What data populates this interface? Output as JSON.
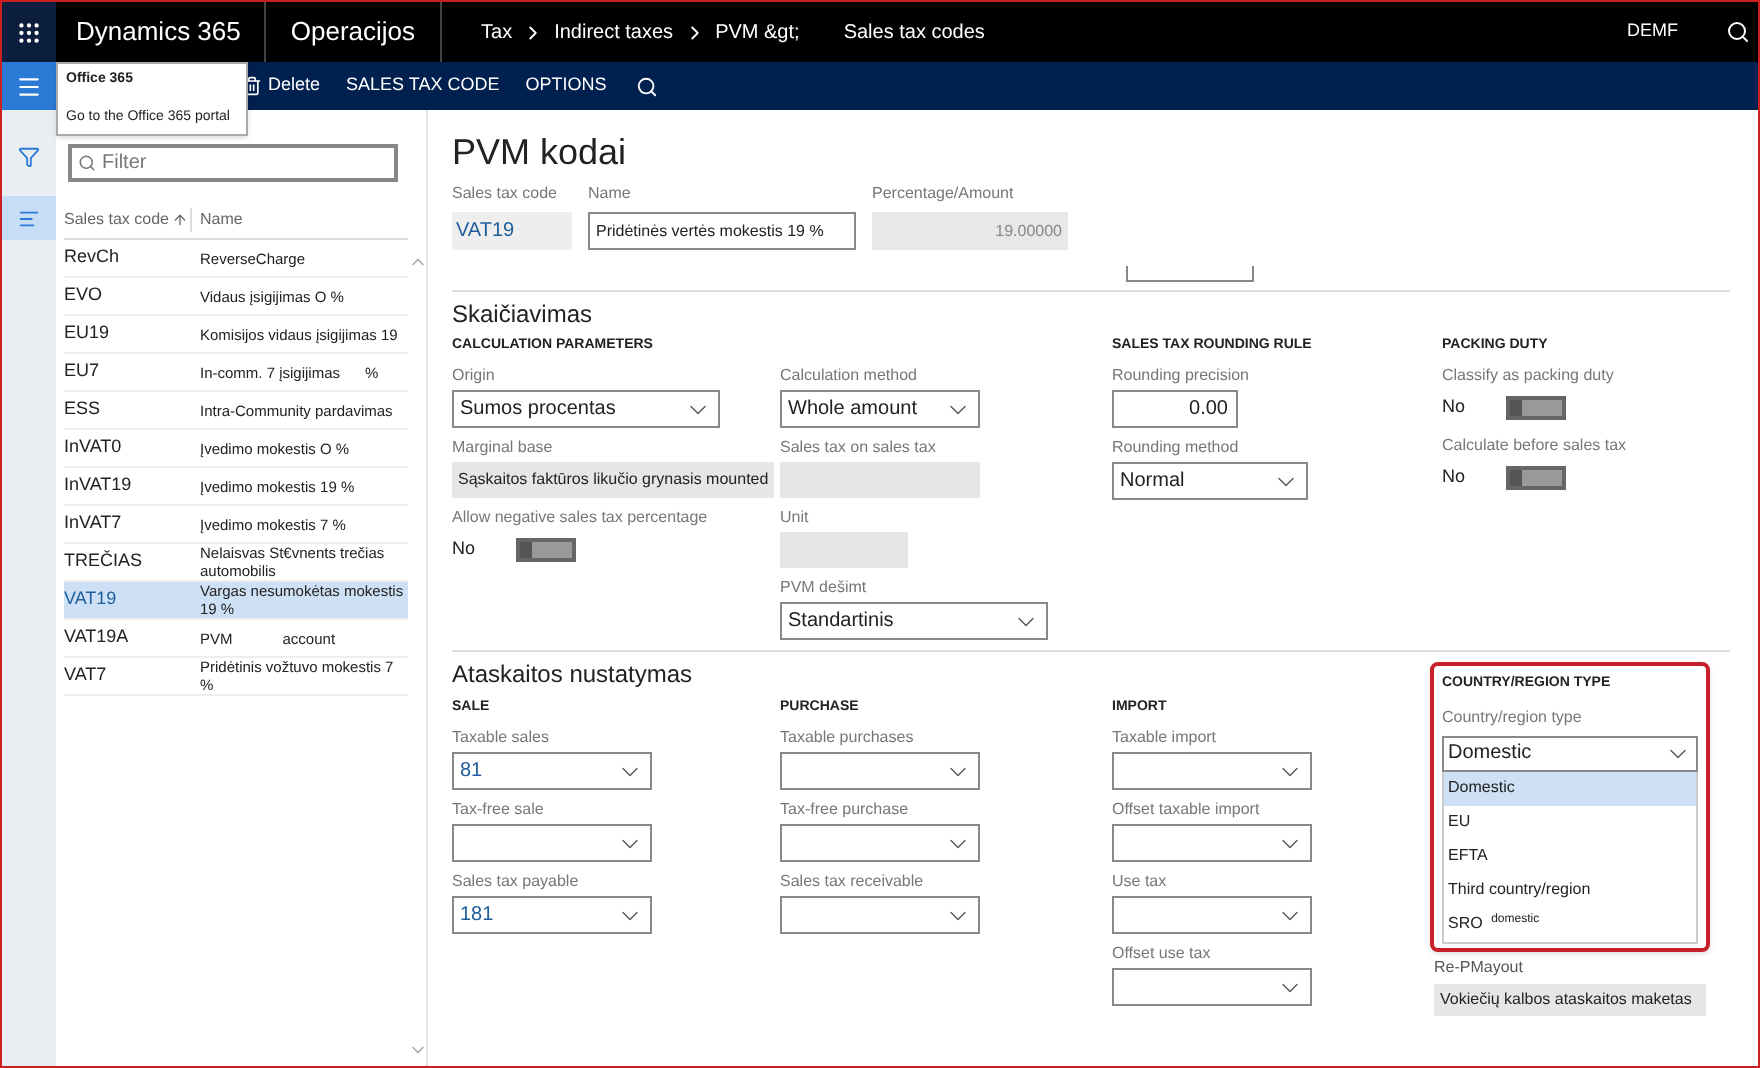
{
  "top_bar": {
    "app": "Dynamics 365",
    "module": "Operacijos",
    "breadcrumb": [
      "Tax",
      "Indirect taxes",
      "PVM &gt;",
      "Sales tax codes"
    ],
    "company": "DEMF"
  },
  "action_bar": {
    "items": [
      "Delete",
      "SALES TAX CODE",
      "OPTIONS"
    ]
  },
  "tooltip": {
    "title": "Office 365",
    "text": "Go to the Office 365 portal"
  },
  "list": {
    "filter_placeholder": "Filter",
    "columns": [
      "Sales tax code",
      "Name"
    ],
    "rows": [
      {
        "code": "RevCh",
        "name": "ReverseCharge",
        "selected": false
      },
      {
        "code": "EVO",
        "name": "Vidaus įsigijimas O %",
        "selected": false
      },
      {
        "code": "EU19",
        "name": "Komisijos vidaus įsigijimas 19",
        "selected": false
      },
      {
        "code": "EU7",
        "name": "In-comm. 7 įsigijimas      %",
        "selected": false
      },
      {
        "code": "ESS",
        "name": "Intra-Community pardavimas",
        "selected": false
      },
      {
        "code": "InVAT0",
        "name": "Įvedimo mokestis O %",
        "selected": false
      },
      {
        "code": "InVAT19",
        "name": "Įvedimo mokestis 19 %",
        "selected": false
      },
      {
        "code": "InVAT7",
        "name": "Įvedimo mokestis 7 %",
        "selected": false
      },
      {
        "code": "TREČIAS",
        "name": "Nelaisvas St€vnents trečias automobilis",
        "selected": false
      },
      {
        "code": "VAT19",
        "name": "Vargas nesumokėtas mokestis 19 %",
        "selected": true
      },
      {
        "code": "VAT19A",
        "name": "PVM            account",
        "selected": false
      },
      {
        "code": "VAT7",
        "name": "Pridėtinis vožtuvo mokestis 7 %",
        "selected": false
      }
    ]
  },
  "header": {
    "title": "PVM kodai",
    "fields": [
      {
        "label": "Sales tax code",
        "value": "VAT19",
        "kind": "code"
      },
      {
        "label": "Name",
        "value": "Pridėtinės vertės mokestis 19 %",
        "kind": "input"
      },
      {
        "label": "Percentage/Amount",
        "value": "19.00000",
        "kind": "readonly"
      }
    ]
  },
  "calculation": {
    "title": "Skaičiavimas",
    "columns": [
      {
        "heading": "CALCULATION PARAMETERS",
        "fields": [
          {
            "kind": "select",
            "label": "Origin",
            "value": "Sumos procentas"
          },
          {
            "kind": "readonly",
            "label": "Marginal base",
            "value": "Sąskaitos faktūros likučio grynasis mounted"
          },
          {
            "kind": "toggle",
            "label": "Allow negative sales tax percentage",
            "value": "No",
            "on": false
          }
        ]
      },
      {
        "fields": [
          {
            "kind": "select",
            "label": "Calculation method",
            "value": "Whole amount"
          },
          {
            "kind": "readonly",
            "label": "Sales tax on sales tax"
          },
          {
            "kind": "readonly",
            "label": "Unit"
          },
          {
            "kind": "select",
            "label": "PVM dešimt",
            "value": "Standartinis"
          }
        ]
      },
      {
        "heading": "SALES TAX ROUNDING RULE",
        "fields": [
          {
            "kind": "input",
            "label": "Rounding precision",
            "value": "0.00"
          },
          {
            "kind": "select",
            "label": "Rounding method",
            "value": "Normal"
          }
        ]
      },
      {
        "heading": "PACKING DUTY",
        "fields": [
          {
            "kind": "toggle",
            "label": "Classify as packing duty",
            "value": "No",
            "on": false
          },
          {
            "kind": "toggle",
            "label": "Calculate before sales tax",
            "value": "No",
            "on": false
          }
        ]
      }
    ]
  },
  "reporting": {
    "title": "Ataskaitos nustatymas",
    "columns": [
      {
        "heading": "SALE",
        "fields": [
          {
            "kind": "select",
            "label": "Taxable sales",
            "value": "81"
          },
          {
            "kind": "select",
            "label": "Tax-free sale"
          },
          {
            "kind": "select",
            "label": "Sales tax payable",
            "value": "181"
          }
        ]
      },
      {
        "heading": "PURCHASE",
        "fields": [
          {
            "kind": "select",
            "label": "Taxable purchases"
          },
          {
            "kind": "select",
            "label": "Tax-free purchase"
          },
          {
            "kind": "select",
            "label": "Sales tax receivable"
          }
        ]
      },
      {
        "heading": "IMPORT",
        "fields": [
          {
            "kind": "select",
            "label": "Taxable import"
          },
          {
            "kind": "select",
            "label": "Offset taxable import"
          },
          {
            "kind": "select",
            "label": "Use tax"
          },
          {
            "kind": "select",
            "label": "Offset use tax"
          }
        ]
      }
    ],
    "country": {
      "heading": "COUNTRY/REGION TYPE",
      "label": "Country/region type",
      "value": "Domestic",
      "options": [
        {
          "label": "Domestic",
          "selected": true
        },
        {
          "label": "EU",
          "selected": false
        },
        {
          "label": "EFTA",
          "selected": false
        },
        {
          "label": "Third country/region",
          "selected": false
        },
        {
          "label": "SRO $^{domestic}$",
          "selected": false
        }
      ]
    },
    "layout": {
      "label": "Re-PMayout",
      "value": "Vokiečių kalbos ataskaitos maketas"
    }
  }
}
